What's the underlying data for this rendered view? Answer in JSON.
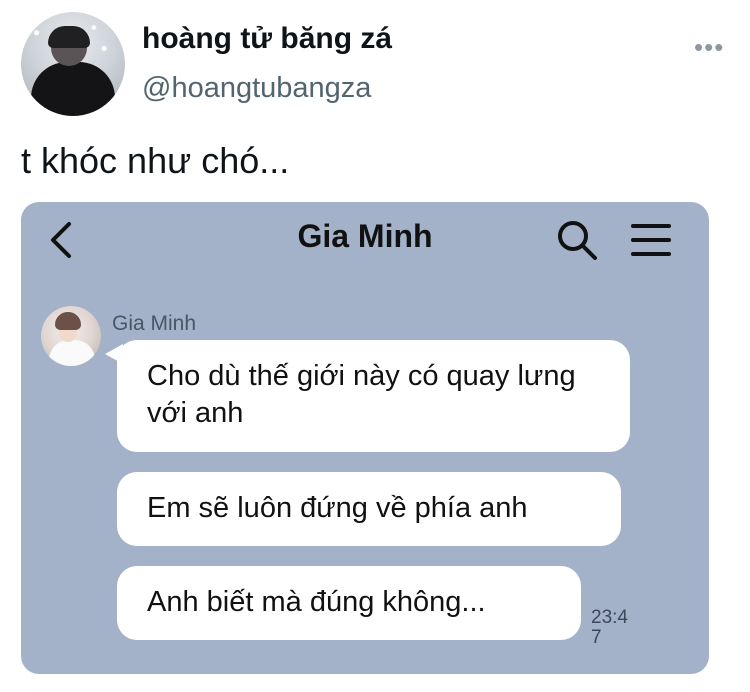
{
  "tweet": {
    "display_name": "hoàng tử băng zá",
    "handle": "@hoangtubangza",
    "more_label": "•••",
    "text": "t khóc như chó..."
  },
  "chat": {
    "title": "Gia Minh",
    "sender_name": "Gia Minh",
    "messages": [
      {
        "text": "Cho dù thế giới này có quay lưng với anh"
      },
      {
        "text": "Em sẽ luôn đứng về phía anh"
      },
      {
        "text": "Anh biết mà đúng không..."
      }
    ],
    "timestamp": "23:47",
    "icons": [
      "chevron-left-icon",
      "search-icon",
      "menu-icon"
    ],
    "colors": {
      "chat_background": "#a3b2c8",
      "bubble": "#ffffff",
      "handle": "#536471"
    }
  }
}
